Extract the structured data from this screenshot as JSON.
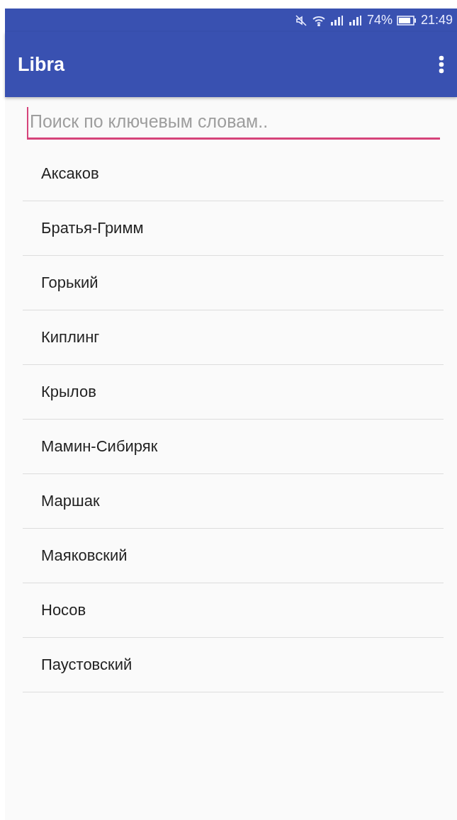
{
  "status_bar": {
    "battery_percent": "74%",
    "time": "21:49"
  },
  "app_bar": {
    "title": "Libra"
  },
  "search": {
    "placeholder": "Поиск по ключевым словам.."
  },
  "authors": [
    {
      "name": "Аксаков"
    },
    {
      "name": "Братья-Гримм"
    },
    {
      "name": "Горький"
    },
    {
      "name": "Киплинг"
    },
    {
      "name": "Крылов"
    },
    {
      "name": "Мамин-Сибиряк"
    },
    {
      "name": "Маршак"
    },
    {
      "name": "Маяковский"
    },
    {
      "name": "Носов"
    },
    {
      "name": "Паустовский"
    }
  ]
}
